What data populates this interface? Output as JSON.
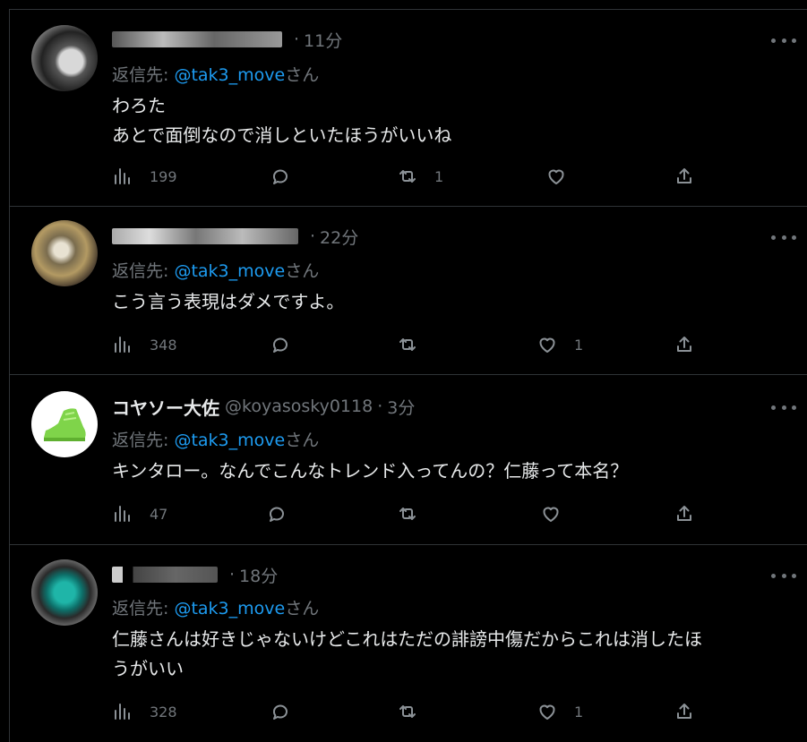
{
  "tweets": [
    {
      "time": "11分",
      "reply_label": "返信先:",
      "mention": "@tak3_move",
      "reply_suffix": "さん",
      "lines": [
        "わろた",
        "あとで面倒なので消しといたほうがいいね"
      ],
      "views": "199",
      "reply_count": "",
      "retweets": "1",
      "likes": ""
    },
    {
      "time": "22分",
      "reply_label": "返信先:",
      "mention": "@tak3_move",
      "reply_suffix": "さん",
      "lines": [
        "こう言う表現はダメですよ。"
      ],
      "views": "348",
      "reply_count": "",
      "retweets": "",
      "likes": "1"
    },
    {
      "name": "コヤソー大佐",
      "handle": "@koyasosky0118",
      "time": "3分",
      "reply_label": "返信先:",
      "mention": "@tak3_move",
      "reply_suffix": "さん",
      "lines": [
        "キンタロー。なんでこんなトレンド入ってんの？仁藤って本名？"
      ],
      "views": "47",
      "reply_count": "",
      "retweets": "",
      "likes": ""
    },
    {
      "time": "18分",
      "reply_label": "返信先:",
      "mention": "@tak3_move",
      "reply_suffix": "さん",
      "lines": [
        "仁藤さんは好きじゃないけどこれはただの誹謗中傷だからこれは消したほ",
        "うがいい"
      ],
      "views": "328",
      "reply_count": "",
      "retweets": "",
      "likes": "1"
    }
  ],
  "icons": {
    "views": "bar-chart-icon",
    "reply": "speech-bubble-icon",
    "retweet": "retweet-icon",
    "like": "heart-icon",
    "share": "share-icon",
    "more": "ellipsis-icon"
  },
  "colors": {
    "background": "#000000",
    "text": "#e7e9ea",
    "muted": "#71767b",
    "mention": "#1d9bf0",
    "divider": "#2f3336"
  }
}
